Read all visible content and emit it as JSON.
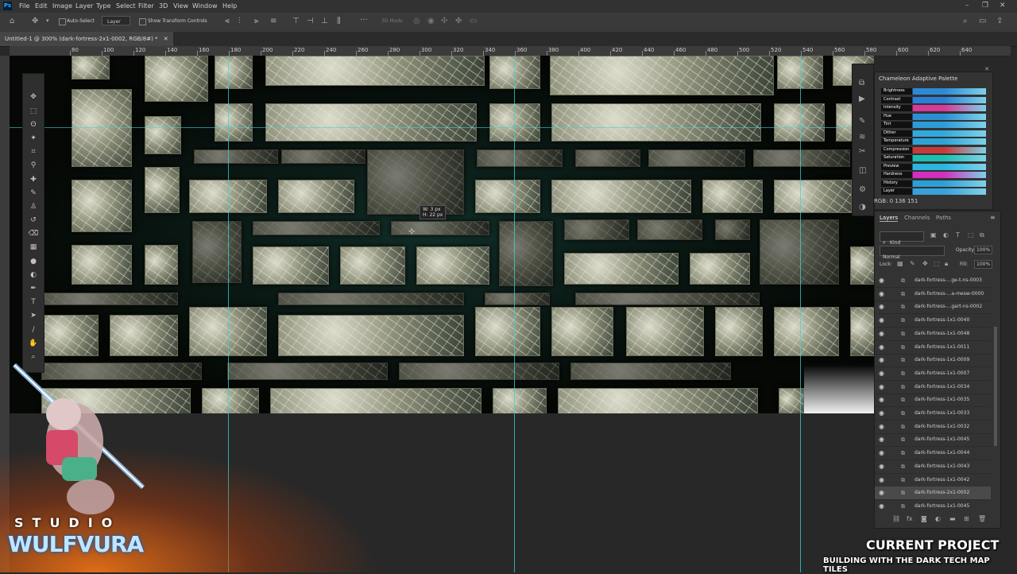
{
  "app": {
    "logo": "Ps"
  },
  "menu": [
    "File",
    "Edit",
    "Image",
    "Layer",
    "Type",
    "Select",
    "Filter",
    "3D",
    "View",
    "Window",
    "Help"
  ],
  "options_bar": {
    "auto_select_label": "Auto-Select",
    "layer_select": "Layer",
    "show_transform_label": "Show Transform Controls",
    "mode_label": "3D Mode"
  },
  "document_tab": "Untitled-1 @ 300% (dark-fortress-2x1-0002, RGB/8#) *",
  "ruler_labels": [
    "80",
    "100",
    "120",
    "140",
    "160",
    "180",
    "200",
    "220",
    "240",
    "260",
    "280",
    "300",
    "320",
    "340",
    "360",
    "380",
    "400",
    "420",
    "440",
    "460",
    "480",
    "500",
    "520",
    "540",
    "560",
    "580",
    "600",
    "620",
    "640"
  ],
  "measure_tooltip": {
    "line1": "W: 3 px",
    "line2": "H: 22 px"
  },
  "palette": {
    "title": "Chameleon Adaptive Palette",
    "sliders": [
      "Brightness",
      "Contrast",
      "Intensity",
      "Hue",
      "Tint",
      "Dither",
      "Temperature",
      "Compression",
      "Saturation",
      "Preview",
      "Hardness",
      "History",
      "Layer"
    ],
    "rgb_readout": "RGB: 0 136 151"
  },
  "layers_panel": {
    "tabs": [
      "Layers",
      "Channels",
      "Paths"
    ],
    "filter_kind": "Kind",
    "blend_mode": "Normal",
    "opacity_label": "Opacity:",
    "opacity_value": "100%",
    "lock_label": "Lock:",
    "fill_label": "Fill:",
    "fill_value": "100%",
    "layers": [
      "dark-fortress-...ge-t-ns-0003",
      "dark-fortress-...a-mesw-0000",
      "dark-fortress-...gart-ns-0002",
      "dark-fortress-1x1-0040",
      "dark-fortress-1x1-0048",
      "dark-fortress-1x1-0011",
      "dark-fortress-1x1-0009",
      "dark-fortress-1x1-0007",
      "dark-fortress-1x1-0034",
      "dark-fortress-1x1-0035",
      "dark-fortress-1x1-0033",
      "dark-fortress-1x1-0032",
      "dark-fortress-1x1-0045",
      "dark-fortress-1x1-0044",
      "dark-fortress-1x1-0043",
      "dark-fortress-1x1-0042",
      "dark-fortress-2x1-0002",
      "dark-fortress-1x1-0045"
    ],
    "selected_index": 16
  },
  "overlay": {
    "studio_text": "STUDIO",
    "brand_logo": "WULFVURA",
    "current_project": "CURRENT PROJECT",
    "project_subtitle": "BUILDING WITH THE DARK TECH MAP TILES"
  }
}
